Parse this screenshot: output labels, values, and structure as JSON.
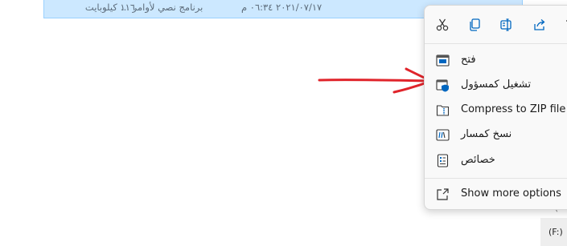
{
  "file_row": {
    "size": "١١٦ كيلوبايت",
    "type": "برنامج نصي لأوامر ...",
    "date": "٢٠٢١/٠٧/١٧ ٠٦:٣٤ م"
  },
  "context_menu": {
    "toolbar": [
      {
        "icon": "cut-icon"
      },
      {
        "icon": "copy-icon"
      },
      {
        "icon": "rename-icon"
      },
      {
        "icon": "share-icon"
      },
      {
        "icon": "delete-icon"
      }
    ],
    "items": [
      {
        "label": "فتح",
        "icon": "open-icon"
      },
      {
        "label": "تشغيل كمسؤول",
        "icon": "run-as-admin-icon"
      },
      {
        "label": "Compress to ZIP file",
        "icon": "zip-icon"
      },
      {
        "label": "نسخ كمسار",
        "icon": "copy-path-icon"
      },
      {
        "label": "خصائص",
        "icon": "properties-icon"
      },
      {
        "label": "Show more options",
        "icon": "show-more-icon"
      }
    ]
  },
  "drive": {
    "label": "(F:)",
    "hint": "("
  },
  "annotation_color": "#e0242b",
  "accent_color": "#0067c0"
}
